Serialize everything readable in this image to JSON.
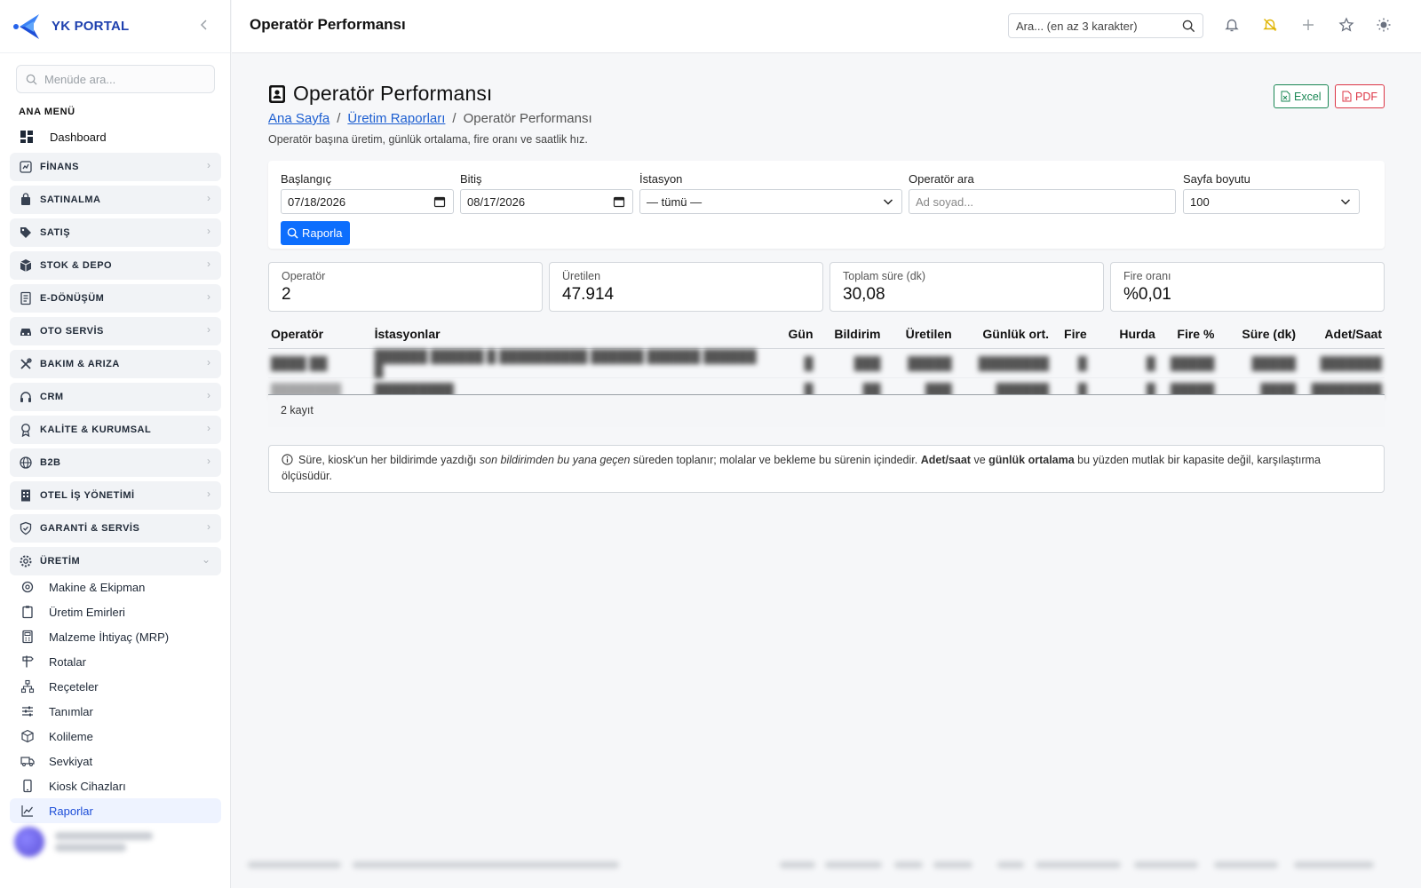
{
  "sidebar": {
    "brand": "YK PORTAL",
    "search_placeholder": "Menüde ara...",
    "section_title": "ANA MENÜ",
    "dashboard": "Dashboard",
    "groups": [
      {
        "label": "FİNANS",
        "icon": "finance-icon"
      },
      {
        "label": "SATINALMA",
        "icon": "shopping-bag-icon"
      },
      {
        "label": "SATIŞ",
        "icon": "tag-icon"
      },
      {
        "label": "STOK & DEPO",
        "icon": "box-icon"
      },
      {
        "label": "E-DÖNÜŞÜM",
        "icon": "document-icon"
      },
      {
        "label": "OTO SERVİS",
        "icon": "car-icon"
      },
      {
        "label": "BAKIM & ARIZA",
        "icon": "tools-icon"
      },
      {
        "label": "CRM",
        "icon": "headset-icon"
      },
      {
        "label": "KALİTE & KURUMSAL",
        "icon": "award-icon"
      },
      {
        "label": "B2B",
        "icon": "globe-icon"
      },
      {
        "label": "OTEL İŞ YÖNETİMİ",
        "icon": "building-icon"
      },
      {
        "label": "GARANTİ & SERVİS",
        "icon": "shield-icon"
      },
      {
        "label": "ÜRETİM",
        "icon": "gear-icon"
      }
    ],
    "production_items": [
      {
        "label": "Makine & Ekipman",
        "icon": "machine-icon"
      },
      {
        "label": "Üretim Emirleri",
        "icon": "clipboard-icon"
      },
      {
        "label": "Malzeme İhtiyaç (MRP)",
        "icon": "calculator-icon"
      },
      {
        "label": "Rotalar",
        "icon": "signpost-icon"
      },
      {
        "label": "Reçeteler",
        "icon": "diagram-icon"
      },
      {
        "label": "Tanımlar",
        "icon": "sliders-icon"
      },
      {
        "label": "Kolileme",
        "icon": "package-icon"
      },
      {
        "label": "Sevkiyat",
        "icon": "truck-icon"
      },
      {
        "label": "Kiosk Cihazları",
        "icon": "tablet-icon"
      },
      {
        "label": "Raporlar",
        "icon": "chart-line-icon"
      }
    ]
  },
  "topbar": {
    "title": "Operatör Performansı",
    "search_placeholder": "Ara... (en az 3 karakter)"
  },
  "page": {
    "title": "Operatör Performansı",
    "breadcrumb": {
      "home": "Ana Sayfa",
      "parent": "Üretim Raporları",
      "current": "Operatör Performansı",
      "sep": "/"
    },
    "subtitle": "Operatör başına üretim, günlük ortalama, fire oranı ve saatlik hız.",
    "export_excel": "Excel",
    "export_pdf": "PDF"
  },
  "filters": {
    "start_label": "Başlangıç",
    "start_value": "07/18/2026",
    "end_label": "Bitiş",
    "end_value": "08/17/2026",
    "station_label": "İstasyon",
    "station_value": "— tümü —",
    "operator_label": "Operatör ara",
    "operator_placeholder": "Ad soyad...",
    "page_size_label": "Sayfa boyutu",
    "page_size_value": "100",
    "report_button": "Raporla"
  },
  "stats": [
    {
      "label": "Operatör",
      "value": "2"
    },
    {
      "label": "Üretilen",
      "value": "47.914"
    },
    {
      "label": "Toplam süre (dk)",
      "value": "30,08"
    },
    {
      "label": "Fire oranı",
      "value": "%0,01"
    }
  ],
  "table": {
    "headers": [
      "Operatör",
      "İstasyonlar",
      "Gün",
      "Bildirim",
      "Üretilen",
      "Günlük ort.",
      "Fire",
      "Hurda",
      "Fire %",
      "Süre (dk)",
      "Adet/Saat"
    ],
    "footer": "2 kayıt"
  },
  "note": {
    "p1": "Süre, kiosk'un her bildirimde yazdığı ",
    "em": "son bildirimden bu yana geçen",
    "p2": " süreden toplanır; molalar ve bekleme bu sürenin içindedir. ",
    "b1": "Adet/saat",
    "p3": " ve ",
    "b2": "günlük ortalama",
    "p4": " bu yüzden mutlak bir kapasite değil, karşılaştırma ölçüsüdür."
  }
}
